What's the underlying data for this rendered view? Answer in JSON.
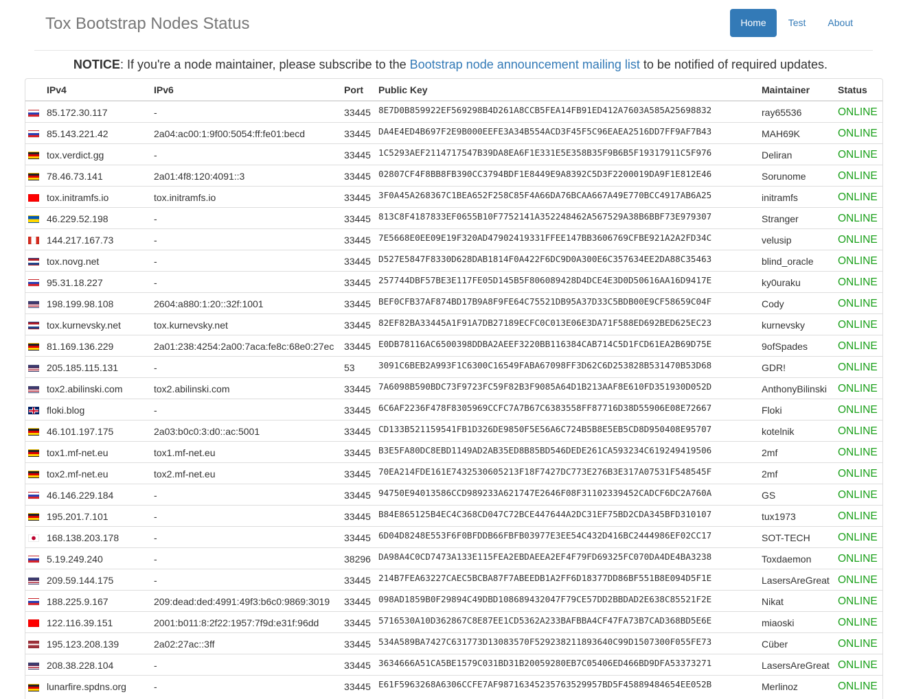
{
  "brand": "Tox Bootstrap Nodes Status",
  "nav": {
    "home": "Home",
    "test": "Test",
    "about": "About"
  },
  "notice": {
    "bold": "NOTICE",
    "before": ": If you're a node maintainer, please subscribe to the ",
    "link": "Bootstrap node announcement mailing list",
    "after": " to be notified of required updates."
  },
  "columns": {
    "ipv4": "IPv4",
    "ipv6": "IPv6",
    "port": "Port",
    "key": "Public Key",
    "maintainer": "Maintainer",
    "status": "Status"
  },
  "flags": {
    "ru": "linear-gradient(#ffffff 0 33.3%, #2a3fb4 33.3% 66.6%, #d8232a 66.6%)",
    "de": "linear-gradient(#222222 0 33.3%, #dd0000 33.3% 66.6%, #ffce00 66.6%)",
    "tw": "linear-gradient(#fe0000, #fe0000)",
    "ua": "linear-gradient(#0057b7 0 50%, #ffd700 50%)",
    "ca": "linear-gradient(90deg, #d52b1e 0 25%, #ffffff 25% 75%, #d52b1e 75%)",
    "nl": "linear-gradient(#ae1c28 0 33.3%, #ffffff 33.3% 66.6%, #21468b 66.6%)",
    "us": "linear-gradient(#3c3b6e 0 50%, transparent 50%), repeating-linear-gradient(#b22234 0 1.6px, #ffffff 1.6px 3.2px)",
    "gb": "linear-gradient(#c8102e, #c8102e) center/100% 2px no-repeat, linear-gradient(#c8102e, #c8102e) center/2px 100% no-repeat, linear-gradient(#ffffff, #ffffff) center/100% 4px no-repeat, linear-gradient(#ffffff, #ffffff) center/4px 100% no-repeat, linear-gradient(#012169, #012169)",
    "jp": "radial-gradient(circle, #bc002d 0 2.6px, #ffffff 3px)",
    "lv": "linear-gradient(#9e3039 0 40%, #ffffff 40% 60%, #9e3039 60%)"
  },
  "rows": [
    {
      "flag": "ru",
      "ipv4": "85.172.30.117",
      "ipv6": "-",
      "port": "33445",
      "key": "8E7D0B859922EF569298B4D261A8CCB5FEA14FB91ED412A7603A585A25698832",
      "maintainer": "ray65536",
      "status": "ONLINE"
    },
    {
      "flag": "ru",
      "ipv4": "85.143.221.42",
      "ipv6": "2a04:ac00:1:9f00:5054:ff:fe01:becd",
      "port": "33445",
      "key": "DA4E4ED4B697F2E9B000EEFE3A34B554ACD3F45F5C96EAEA2516DD7FF9AF7B43",
      "maintainer": "MAH69K",
      "status": "ONLINE"
    },
    {
      "flag": "de",
      "ipv4": "tox.verdict.gg",
      "ipv6": "-",
      "port": "33445",
      "key": "1C5293AEF2114717547B39DA8EA6F1E331E5E358B35F9B6B5F19317911C5F976",
      "maintainer": "Deliran",
      "status": "ONLINE"
    },
    {
      "flag": "de",
      "ipv4": "78.46.73.141",
      "ipv6": "2a01:4f8:120:4091::3",
      "port": "33445",
      "key": "02807CF4F8BB8FB390CC3794BDF1E8449E9A8392C5D3F2200019DA9F1E812E46",
      "maintainer": "Sorunome",
      "status": "ONLINE"
    },
    {
      "flag": "tw",
      "ipv4": "tox.initramfs.io",
      "ipv6": "tox.initramfs.io",
      "port": "33445",
      "key": "3F0A45A268367C1BEA652F258C85F4A66DA76BCAA667A49E770BCC4917AB6A25",
      "maintainer": "initramfs",
      "status": "ONLINE"
    },
    {
      "flag": "ua",
      "ipv4": "46.229.52.198",
      "ipv6": "-",
      "port": "33445",
      "key": "813C8F4187833EF0655B10F7752141A352248462A567529A38B6BBF73E979307",
      "maintainer": "Stranger",
      "status": "ONLINE"
    },
    {
      "flag": "ca",
      "ipv4": "144.217.167.73",
      "ipv6": "-",
      "port": "33445",
      "key": "7E5668E0EE09E19F320AD47902419331FFEE147BB3606769CFBE921A2A2FD34C",
      "maintainer": "velusip",
      "status": "ONLINE"
    },
    {
      "flag": "nl",
      "ipv4": "tox.novg.net",
      "ipv6": "-",
      "port": "33445",
      "key": "D527E5847F8330D628DAB1814F0A422F6DC9D0A300E6C357634EE2DA88C35463",
      "maintainer": "blind_oracle",
      "status": "ONLINE"
    },
    {
      "flag": "ru",
      "ipv4": "95.31.18.227",
      "ipv6": "-",
      "port": "33445",
      "key": "257744DBF57BE3E117FE05D145B5F806089428D4DCE4E3D0D50616AA16D9417E",
      "maintainer": "ky0uraku",
      "status": "ONLINE"
    },
    {
      "flag": "us",
      "ipv4": "198.199.98.108",
      "ipv6": "2604:a880:1:20::32f:1001",
      "port": "33445",
      "key": "BEF0CFB37AF874BD17B9A8F9FE64C75521DB95A37D33C5BDB00E9CF58659C04F",
      "maintainer": "Cody",
      "status": "ONLINE"
    },
    {
      "flag": "nl",
      "ipv4": "tox.kurnevsky.net",
      "ipv6": "tox.kurnevsky.net",
      "port": "33445",
      "key": "82EF82BA33445A1F91A7DB27189ECFC0C013E06E3DA71F588ED692BED625EC23",
      "maintainer": "kurnevsky",
      "status": "ONLINE"
    },
    {
      "flag": "de",
      "ipv4": "81.169.136.229",
      "ipv6": "2a01:238:4254:2a00:7aca:fe8c:68e0:27ec",
      "port": "33445",
      "key": "E0DB78116AC6500398DDBA2AEEF3220BB116384CAB714C5D1FCD61EA2B69D75E",
      "maintainer": "9ofSpades",
      "status": "ONLINE"
    },
    {
      "flag": "us",
      "ipv4": "205.185.115.131",
      "ipv6": "-",
      "port": "53",
      "key": "3091C6BEB2A993F1C6300C16549FABA67098FF3D62C6D253828B531470B53D68",
      "maintainer": "GDR!",
      "status": "ONLINE"
    },
    {
      "flag": "us",
      "ipv4": "tox2.abilinski.com",
      "ipv6": "tox2.abilinski.com",
      "port": "33445",
      "key": "7A6098B590BDC73F9723FC59F82B3F9085A64D1B213AAF8E610FD351930D052D",
      "maintainer": "AnthonyBilinski",
      "status": "ONLINE"
    },
    {
      "flag": "gb",
      "ipv4": "floki.blog",
      "ipv6": "-",
      "port": "33445",
      "key": "6C6AF2236F478F8305969CCFC7A7B67C6383558FF87716D38D55906E08E72667",
      "maintainer": "Floki",
      "status": "ONLINE"
    },
    {
      "flag": "de",
      "ipv4": "46.101.197.175",
      "ipv6": "2a03:b0c0:3:d0::ac:5001",
      "port": "33445",
      "key": "CD133B521159541FB1D326DE9850F5E56A6C724B5B8E5EB5CD8D950408E95707",
      "maintainer": "kotelnik",
      "status": "ONLINE"
    },
    {
      "flag": "de",
      "ipv4": "tox1.mf-net.eu",
      "ipv6": "tox1.mf-net.eu",
      "port": "33445",
      "key": "B3E5FA80DC8EBD1149AD2AB35ED8B85BD546DEDE261CA593234C619249419506",
      "maintainer": "2mf",
      "status": "ONLINE"
    },
    {
      "flag": "de",
      "ipv4": "tox2.mf-net.eu",
      "ipv6": "tox2.mf-net.eu",
      "port": "33445",
      "key": "70EA214FDE161E7432530605213F18F7427DC773E276B3E317A07531F548545F",
      "maintainer": "2mf",
      "status": "ONLINE"
    },
    {
      "flag": "ru",
      "ipv4": "46.146.229.184",
      "ipv6": "-",
      "port": "33445",
      "key": "94750E94013586CCD989233A621747E2646F08F31102339452CADCF6DC2A760A",
      "maintainer": "GS",
      "status": "ONLINE"
    },
    {
      "flag": "de",
      "ipv4": "195.201.7.101",
      "ipv6": "-",
      "port": "33445",
      "key": "B84E865125B4EC4C368CD047C72BCE447644A2DC31EF75BD2CDA345BFD310107",
      "maintainer": "tux1973",
      "status": "ONLINE"
    },
    {
      "flag": "jp",
      "ipv4": "168.138.203.178",
      "ipv6": "-",
      "port": "33445",
      "key": "6D04D8248E553F6F0BFDDB66FBFB03977E3EE54C432D416BC2444986EF02CC17",
      "maintainer": "SOT-TECH",
      "status": "ONLINE"
    },
    {
      "flag": "ru",
      "ipv4": "5.19.249.240",
      "ipv6": "-",
      "port": "38296",
      "key": "DA98A4C0CD7473A133E115FEA2EBDAEEA2EF4F79FD69325FC070DA4DE4BA3238",
      "maintainer": "Toxdaemon",
      "status": "ONLINE"
    },
    {
      "flag": "us",
      "ipv4": "209.59.144.175",
      "ipv6": "-",
      "port": "33445",
      "key": "214B7FEA63227CAEC5BCBA87F7ABEEDB1A2FF6D18377DD86BF551B8E094D5F1E",
      "maintainer": "LasersAreGreat",
      "status": "ONLINE"
    },
    {
      "flag": "ru",
      "ipv4": "188.225.9.167",
      "ipv6": "209:dead:ded:4991:49f3:b6c0:9869:3019",
      "port": "33445",
      "key": "098AD1859B0F29894C49DBD108689432047F79CE57DD2BBDAD2E638C85521F2E",
      "maintainer": "Nikat",
      "status": "ONLINE"
    },
    {
      "flag": "tw",
      "ipv4": "122.116.39.151",
      "ipv6": "2001:b011:8:2f22:1957:7f9d:e31f:96dd",
      "port": "33445",
      "key": "5716530A10D362867C8E87EE1CD5362A233BAFBBA4CF47FA73B7CAD368BD5E6E",
      "maintainer": "miaoski",
      "status": "ONLINE"
    },
    {
      "flag": "lv",
      "ipv4": "195.123.208.139",
      "ipv6": "2a02:27ac::3ff",
      "port": "33445",
      "key": "534A589BA7427C631773D13083570F529238211893640C99D1507300F055FE73",
      "maintainer": "Cüber",
      "status": "ONLINE"
    },
    {
      "flag": "us",
      "ipv4": "208.38.228.104",
      "ipv6": "-",
      "port": "33445",
      "key": "3634666A51CA5BE1579C031BD31B20059280EB7C05406ED466BD9DFA53373271",
      "maintainer": "LasersAreGreat",
      "status": "ONLINE"
    },
    {
      "flag": "de",
      "ipv4": "lunarfire.spdns.org",
      "ipv6": "-",
      "port": "33445",
      "key": "E61F5963268A6306CCFE7AF98716345235763529957BD5F45889484654EE052B",
      "maintainer": "Merlinoz",
      "status": "ONLINE"
    }
  ]
}
